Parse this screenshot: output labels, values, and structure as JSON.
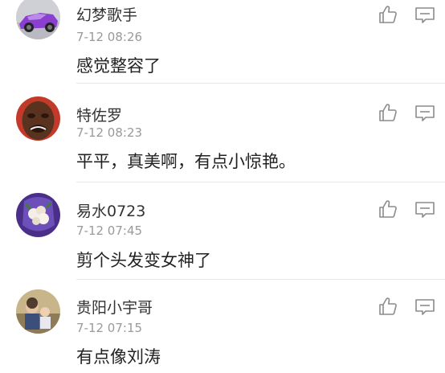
{
  "comments": [
    {
      "username": "幻梦歌手",
      "time": "7-12 08:26",
      "text": "感觉整容了",
      "avatar": "purple-sports-car"
    },
    {
      "username": "特佐罗",
      "time": "7-12 08:23",
      "text": "平平，真美啊，有点小惊艳。",
      "avatar": "crying-face"
    },
    {
      "username": "易水0723",
      "time": "7-12 07:45",
      "text": "剪个头发变女神了",
      "avatar": "flower-bouquet"
    },
    {
      "username": "贵阳小宇哥",
      "time": "7-12 07:15",
      "text": "有点像刘涛",
      "avatar": "family-photo"
    }
  ],
  "icons": {
    "like": "thumbs-up-icon",
    "reply": "comment-icon"
  },
  "colors": {
    "icon_stroke": "#8c8c8c",
    "username": "#333333",
    "timestamp": "#9a9a9a",
    "text": "#222222",
    "divider": "#e8e8e8"
  }
}
